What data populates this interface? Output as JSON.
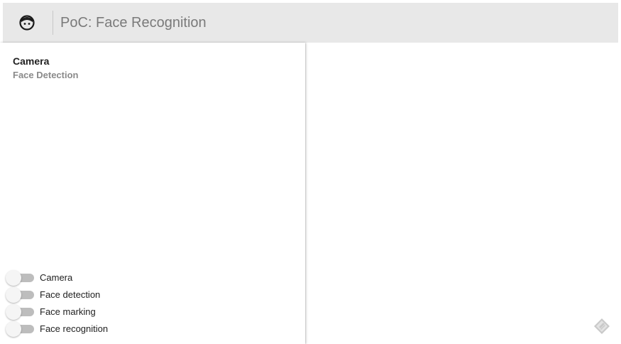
{
  "header": {
    "title": "PoC: Face Recognition",
    "logo_icon": "face-icon"
  },
  "card": {
    "title": "Camera",
    "subtitle": "Face Detection"
  },
  "toggles": [
    {
      "label": "Camera",
      "on": false
    },
    {
      "label": "Face detection",
      "on": false
    },
    {
      "label": "Face marking",
      "on": false
    },
    {
      "label": "Face recognition",
      "on": false
    }
  ],
  "corner_icon": "diamond-logo-icon",
  "colors": {
    "toolbar_bg": "#e8e8e8",
    "title_color": "#7a7a7a",
    "toggle_track_off": "#bdbdbd",
    "toggle_thumb_off": "#f5f5f5"
  }
}
